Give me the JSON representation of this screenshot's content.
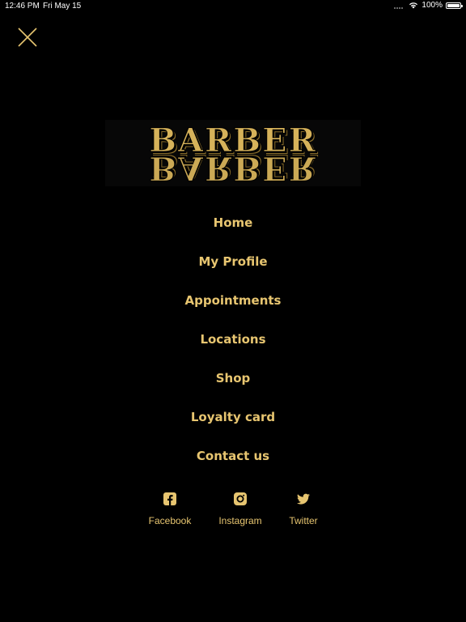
{
  "status_bar": {
    "time": "12:46 PM",
    "date": "Fri May 15",
    "battery_percent": "100%",
    "battery_level": 1.0
  },
  "colors": {
    "background": "#000000",
    "accent_gold": "#e7c570",
    "logo_gold": "#d6b25a"
  },
  "close_icon": "close-x-icon",
  "logo": {
    "text": "BARBER"
  },
  "menu": {
    "items": [
      {
        "label": "Home"
      },
      {
        "label": "My Profile"
      },
      {
        "label": "Appointments"
      },
      {
        "label": "Locations"
      },
      {
        "label": "Shop"
      },
      {
        "label": "Loyalty card"
      },
      {
        "label": "Contact us"
      }
    ]
  },
  "social": {
    "items": [
      {
        "label": "Facebook",
        "icon": "facebook-icon"
      },
      {
        "label": "Instagram",
        "icon": "instagram-icon"
      },
      {
        "label": "Twitter",
        "icon": "twitter-icon"
      }
    ]
  }
}
